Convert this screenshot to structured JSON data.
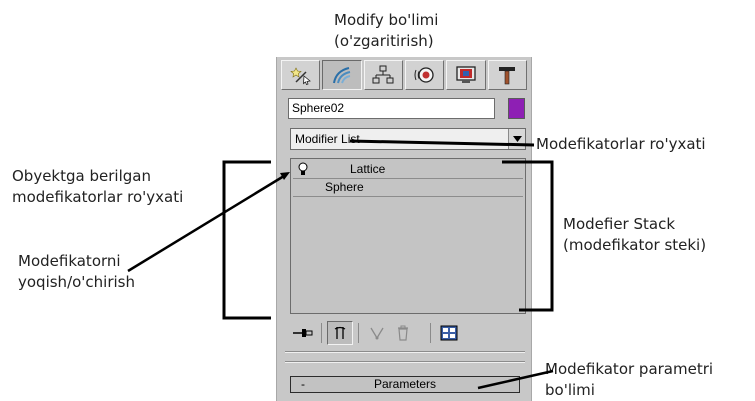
{
  "annotations": {
    "modify_section": [
      "Modify bo'limi",
      "(o'zgaritirish)"
    ],
    "modifier_list": "Modefikatorlar ro'yxati",
    "assigned_modifiers": [
      "Obyektga berilgan",
      "modefikatorlar ro'yxati"
    ],
    "modifier_stack": [
      "Modefier Stack",
      "(modefikator steki)"
    ],
    "toggle_modifier": [
      "Modefikatorni",
      "yoqish/o'chirish"
    ],
    "parameters_section": [
      "Modefikator parametri",
      "bo'limi"
    ]
  },
  "panel": {
    "tabs": [
      {
        "name": "create",
        "icon": "create-wand-icon"
      },
      {
        "name": "modify",
        "icon": "modify-bend-icon",
        "active": true
      },
      {
        "name": "hierarchy",
        "icon": "hierarchy-icon"
      },
      {
        "name": "motion",
        "icon": "motion-icon"
      },
      {
        "name": "display",
        "icon": "display-icon"
      },
      {
        "name": "utilities",
        "icon": "utilities-hammer-icon"
      }
    ],
    "object_name": "Sphere02",
    "object_color": "#8e1fb4",
    "modifier_list_label": "Modifier List",
    "stack": [
      {
        "label": "Lattice",
        "has_bulb": true
      },
      {
        "label": "Sphere",
        "has_bulb": false
      }
    ],
    "rollout": {
      "sign": "-",
      "title": "Parameters"
    }
  }
}
